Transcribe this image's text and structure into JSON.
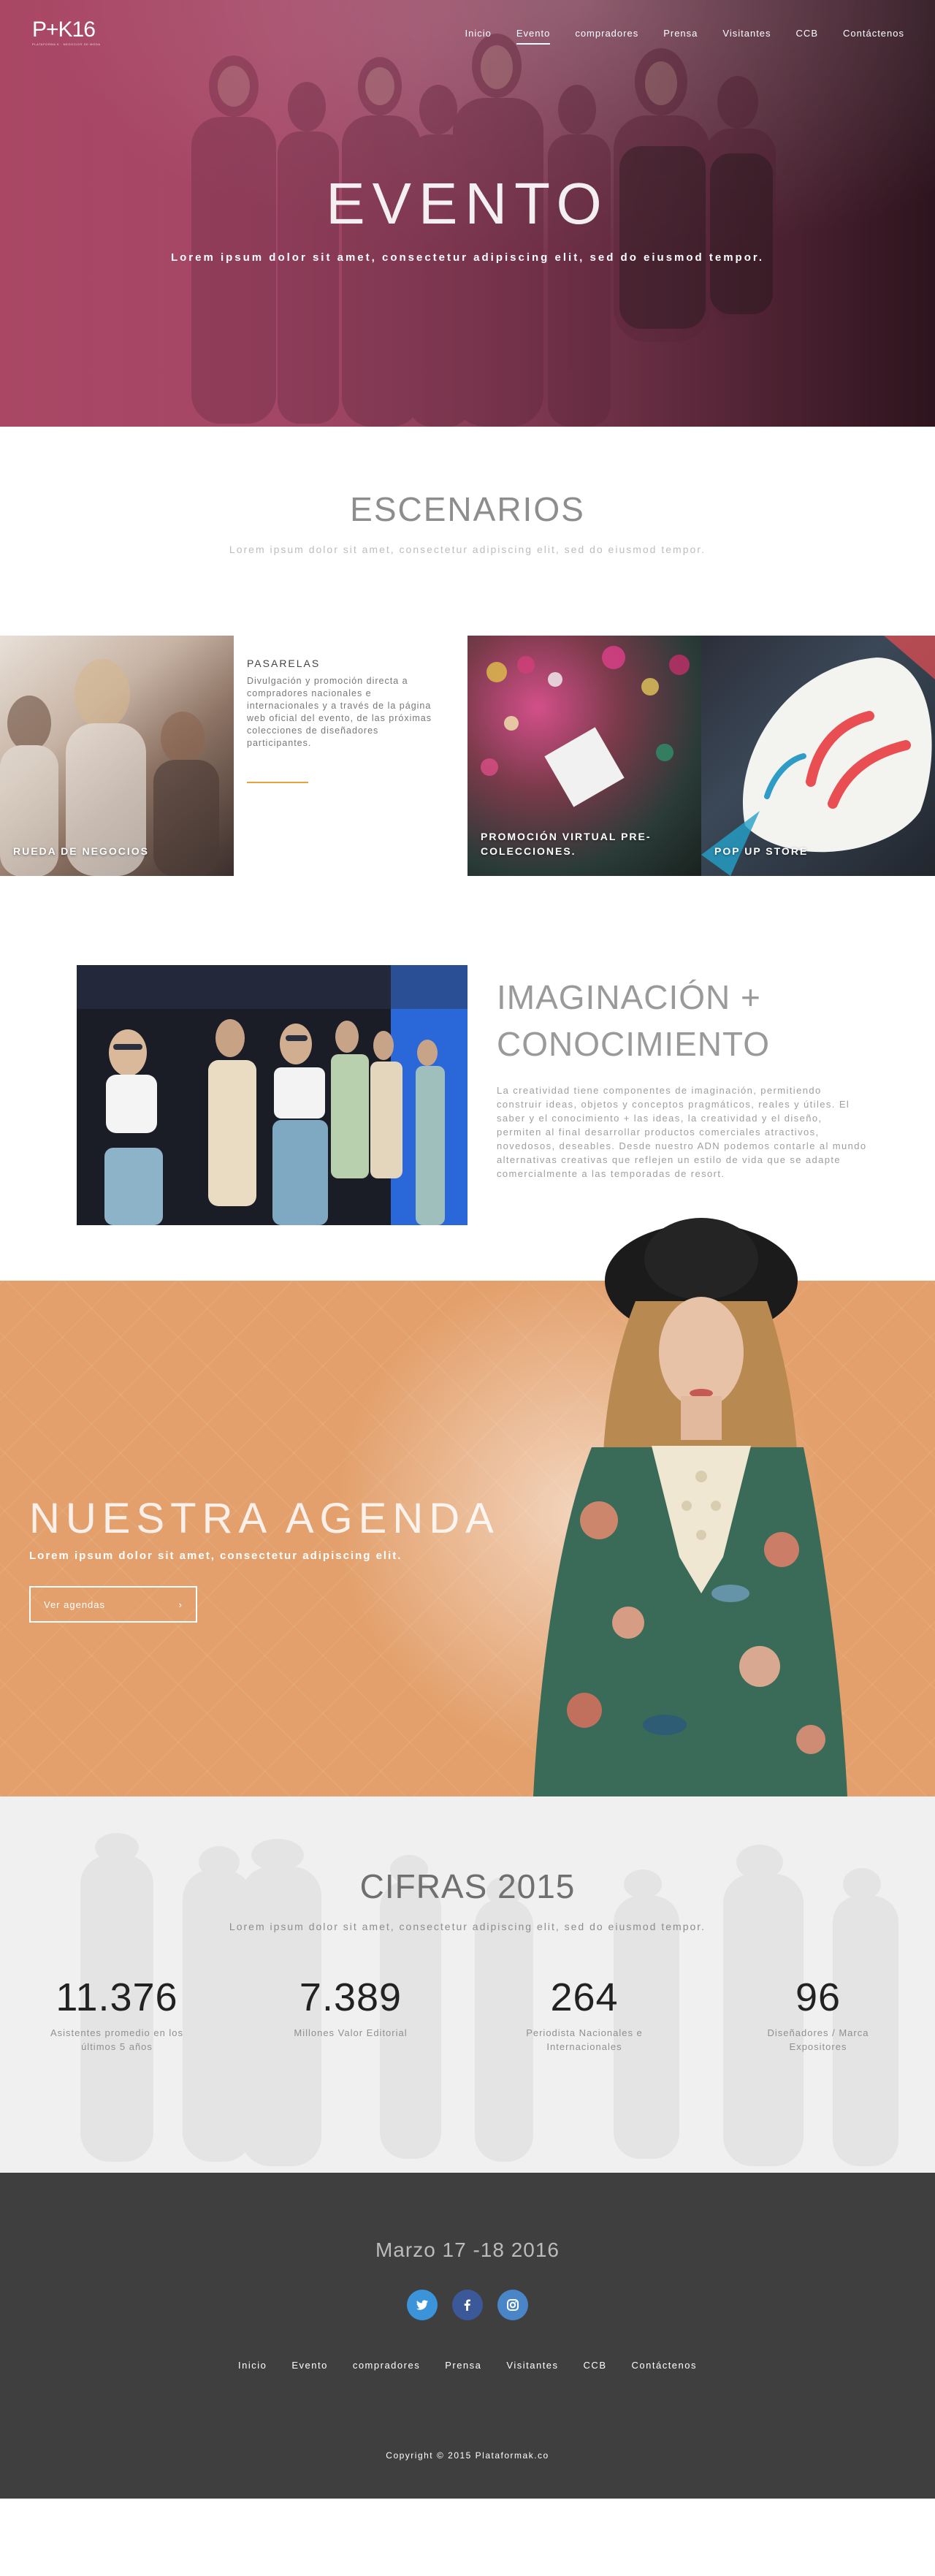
{
  "brand": {
    "logo_text": "P+K16",
    "logo_tagline": "PLATAFORMA K · NEGOCIOS DE MODA"
  },
  "nav": {
    "items": [
      {
        "label": "Inicio",
        "active": false
      },
      {
        "label": "Evento",
        "active": true
      },
      {
        "label": "compradores",
        "active": false
      },
      {
        "label": "Prensa",
        "active": false
      },
      {
        "label": "Visitantes",
        "active": false
      },
      {
        "label": "CCB",
        "active": false
      },
      {
        "label": "Contáctenos",
        "active": false
      }
    ]
  },
  "hero": {
    "title": "EVENTO",
    "subtitle": "Lorem ipsum dolor sit amet, consectetur adipiscing elit, sed do eiusmod tempor."
  },
  "escenarios": {
    "title": "ESCENARIOS",
    "subtitle": "Lorem ipsum dolor sit amet, consectetur adipiscing elit, sed do eiusmod tempor.",
    "tiles": [
      {
        "label": "RUEDA DE NEGOCIOS"
      },
      {
        "title": "PASARELAS",
        "body": "Divulgación y promoción directa a compradores nacionales e internacionales y a través de la página web oficial del evento, de las próximas colecciones de diseñadores participantes."
      },
      {
        "label": "PROMOCIÓN VIRTUAL PRE-COLECCIONES."
      },
      {
        "label": "POP UP STORE"
      }
    ]
  },
  "imaginacion": {
    "title": "IMAGINACIÓN + CONOCIMIENTO",
    "text": "La creatividad tiene componentes de imaginación, permitiendo construir ideas, objetos y conceptos pragmáticos, reales y útiles. El saber y el conocimiento + las ideas, la creatividad y el diseño, permiten al final desarrollar productos comerciales atractivos, novedosos, deseables. Desde nuestro ADN podemos contarle al mundo alternativas creativas que reflejen un estilo de vida que se adapte comercialmente a las temporadas de resort."
  },
  "agenda": {
    "title": "NUESTRA AGENDA",
    "subtitle": "Lorem ipsum dolor sit amet, consectetur adipiscing elit.",
    "button_label": "Ver agendas",
    "button_arrow": "›"
  },
  "cifras": {
    "title": "CIFRAS 2015",
    "subtitle": "Lorem ipsum dolor sit amet, consectetur adipiscing elit, sed do eiusmod tempor.",
    "stats": [
      {
        "value": "11.376",
        "label": "Asistentes promedio en los últimos 5 años"
      },
      {
        "value": "7.389",
        "label": "Millones Valor Editorial"
      },
      {
        "value": "264",
        "label": "Periodista Nacionales e Internacionales"
      },
      {
        "value": "96",
        "label": "Diseñadores / Marca Expositores"
      }
    ]
  },
  "footer": {
    "date": "Marzo 17 -18 2016",
    "socials": [
      {
        "name": "twitter-icon",
        "glyph": "t"
      },
      {
        "name": "facebook-icon",
        "glyph": "f"
      },
      {
        "name": "instagram-icon",
        "glyph": "◎"
      }
    ],
    "menu": [
      "Inicio",
      "Evento",
      "compradores",
      "Prensa",
      "Visitantes",
      "CCB",
      "Contáctenos"
    ],
    "copyright": "Copyright © 2015 Plataformak.co"
  },
  "colors": {
    "hero_tint": "#a64c6a",
    "accent_underline": "#e5a53a",
    "agenda_orange": "#e3a06c",
    "footer_bg": "#3f3f3f",
    "twitter": "#3b94d9",
    "facebook": "#3b5998",
    "instagram": "#4a86c7"
  }
}
